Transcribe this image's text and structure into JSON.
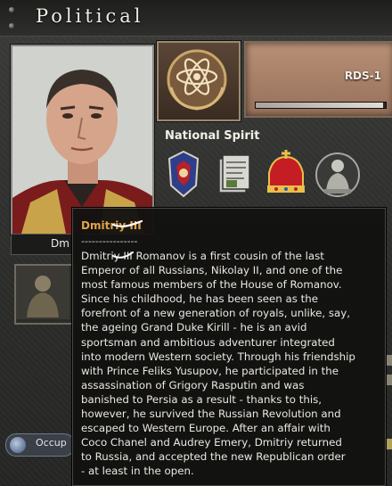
{
  "header": {
    "title": "Political"
  },
  "leader": {
    "name_fragment": "Dm"
  },
  "party": {
    "name": "RDS-1",
    "popularity": 0.98
  },
  "national_spirit": {
    "label": "National Spirit",
    "icons": [
      "security-service-emblem-icon",
      "document-stack-icon",
      "crown-icon",
      "statue-icon"
    ]
  },
  "occupation": {
    "label": "Occup"
  },
  "tooltip": {
    "title": "Dmitriy III",
    "separator": "----------------",
    "body_lines": [
      "Dmitriy III Romanov is a first cousin of the last",
      "Emperor of all Russians, Nikolay II, and one of the",
      "most famous members of the House of Romanov.",
      "Since his childhood, he has been seen as the",
      "forefront of a new generation of royals, unlike, say,",
      "the ageing Grand Duke Kirill - he is an avid",
      "sportsman and ambitious adventurer integrated",
      "into modern Western society. Through his friendship",
      "with Prince Feliks Yusupov, he participated in the",
      "assassination of Grigory Rasputin and was",
      "banished to Persia as a result - thanks to this,",
      "however, he survived the Russian Revolution and",
      "escaped to Western Europe. After an affair with",
      "Coco Chanel and Audrey Emery, Dmitriy returned",
      "to Russia, and accepted the new Republican order",
      "- at least in the open."
    ]
  },
  "colors": {
    "tooltip_title": "#e2a44a",
    "panel": "#2e2f2c"
  }
}
